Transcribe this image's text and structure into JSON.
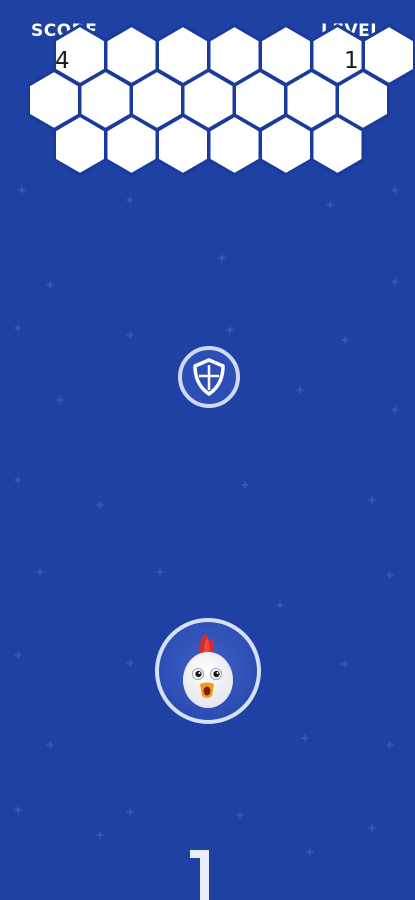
{
  "hud": {
    "score_label": "SCORE",
    "score_value": "4",
    "level_label": "LEVEL",
    "level_value": "1"
  },
  "hex_grid": {
    "rows": [
      7,
      7,
      6
    ],
    "cell_color": "#ffffff",
    "border_color": "#1a3a9c"
  },
  "powerup": {
    "icon": "shield-icon"
  },
  "player": {
    "character": "chicken-icon"
  },
  "counter": {
    "value": "1"
  },
  "colors": {
    "background": "#1f41a3",
    "star": "#3b5cbd",
    "bubble_fill": "#2f52b8",
    "bubble_ring": "#cdd8f7"
  }
}
